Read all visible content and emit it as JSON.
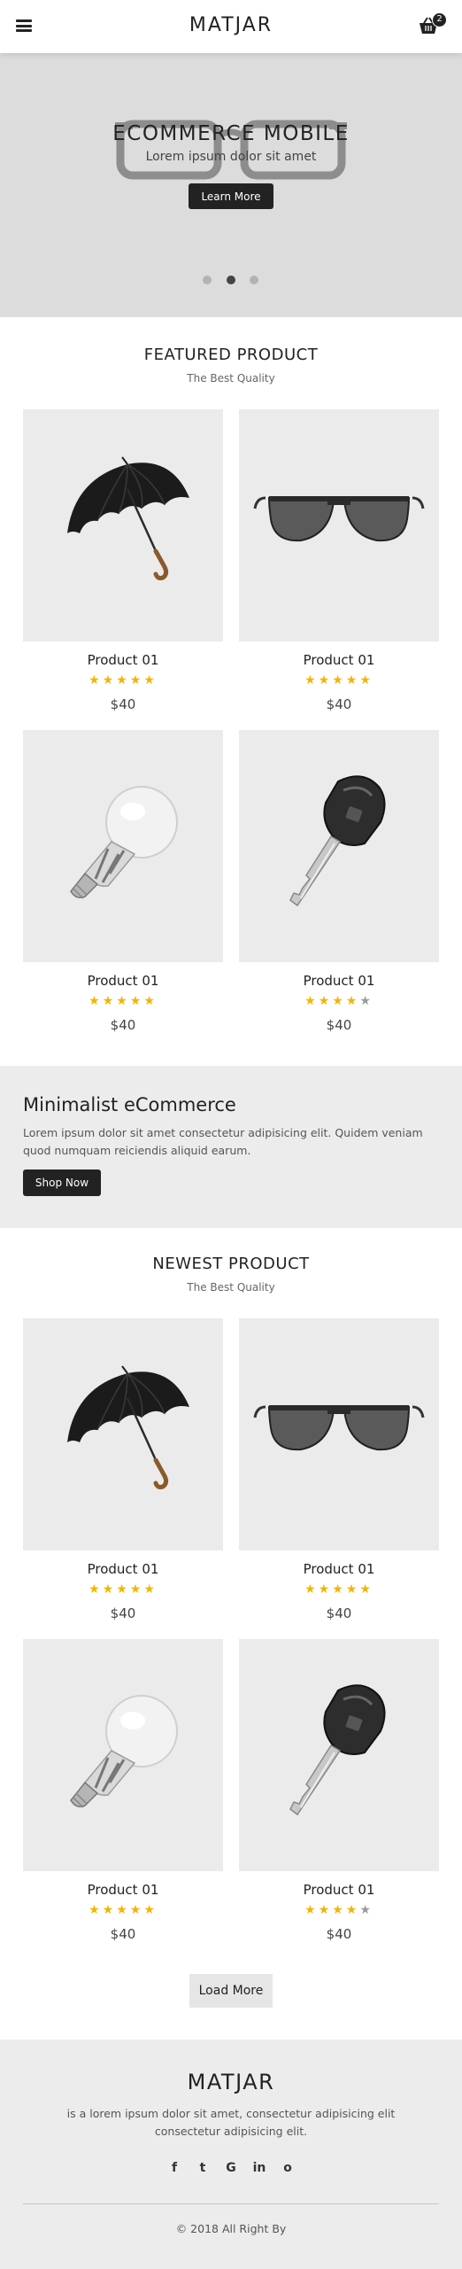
{
  "header": {
    "brand": "MATJAR",
    "cart_count": "2"
  },
  "hero": {
    "title": "ECOMMERCE MOBILE",
    "subtitle": "Lorem ipsum dolor sit amet",
    "button": "Learn More",
    "slides": 3,
    "active_slide": 2
  },
  "featured": {
    "title": "FEATURED PRODUCT",
    "subtitle": "The Best Quality",
    "products": [
      {
        "name": "Product 01",
        "rating": 5,
        "price": "$40",
        "image": "umbrella"
      },
      {
        "name": "Product 01",
        "rating": 5,
        "price": "$40",
        "image": "sunglasses"
      },
      {
        "name": "Product 01",
        "rating": 5,
        "price": "$40",
        "image": "light-bulb"
      },
      {
        "name": "Product 01",
        "rating": 4,
        "price": "$40",
        "image": "key"
      }
    ]
  },
  "banner": {
    "title": "Minimalist eCommerce",
    "text": "Lorem ipsum dolor sit amet consectetur adipisicing elit. Quidem veniam quod numquam reiciendis aliquid earum.",
    "button": "Shop Now"
  },
  "newest": {
    "title": "NEWEST PRODUCT",
    "subtitle": "The Best Quality",
    "products": [
      {
        "name": "Product 01",
        "rating": 5,
        "price": "$40",
        "image": "umbrella"
      },
      {
        "name": "Product 01",
        "rating": 5,
        "price": "$40",
        "image": "sunglasses"
      },
      {
        "name": "Product 01",
        "rating": 5,
        "price": "$40",
        "image": "light-bulb"
      },
      {
        "name": "Product 01",
        "rating": 4,
        "price": "$40",
        "image": "key"
      }
    ],
    "load_more": "Load More"
  },
  "footer": {
    "brand": "MATJAR",
    "text": "is a lorem ipsum dolor sit amet, consectetur adipisicing elit consectetur adipisicing elit.",
    "socials": [
      "f",
      "t",
      "G",
      "in",
      "o"
    ],
    "social_icons": [
      "facebook-icon",
      "twitter-icon",
      "google-icon",
      "linkedin-icon",
      "instagram-icon"
    ],
    "copyright": "© 2018 All Right By"
  },
  "colors": {
    "star": "#f4b400",
    "star_off": "#9a9a9a",
    "dark": "#222222",
    "card_bg": "#ebebeb",
    "hero_bg": "#dcdcdc"
  }
}
